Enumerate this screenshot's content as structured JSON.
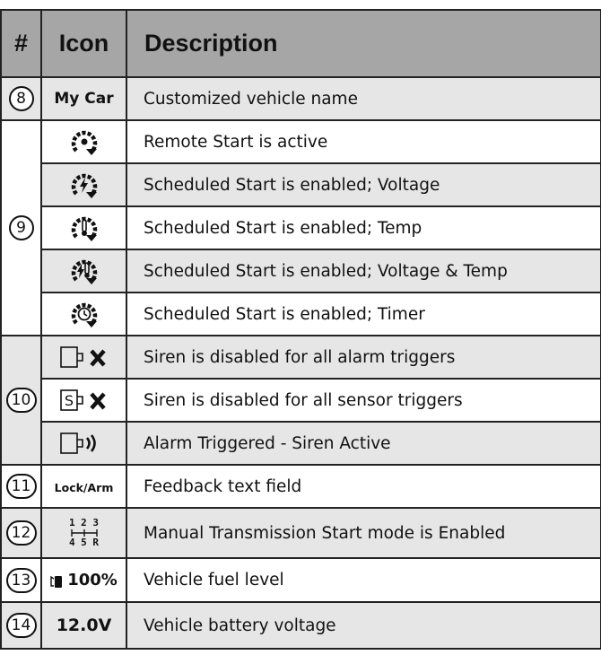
{
  "header": {
    "num": "#",
    "icon": "Icon",
    "description": "Description"
  },
  "rows": {
    "r8": {
      "num": "8",
      "icon_text": "My Car",
      "desc": "Customized vehicle name"
    },
    "r9a": {
      "num": "9",
      "icon": "remote-start-icon",
      "desc": "Remote Start is active"
    },
    "r9b": {
      "icon": "scheduled-voltage-icon",
      "desc": "Scheduled Start is enabled; Voltage"
    },
    "r9c": {
      "icon": "scheduled-temp-icon",
      "desc": "Scheduled Start is enabled; Temp"
    },
    "r9d": {
      "icon": "scheduled-voltage-temp-icon",
      "desc": "Scheduled Start is enabled; Voltage & Temp"
    },
    "r9e": {
      "icon": "scheduled-timer-icon",
      "desc": "Scheduled Start is enabled; Timer"
    },
    "r10a": {
      "num": "10",
      "icon": "siren-alarm-disabled-icon",
      "desc": "Siren is disabled for all alarm triggers"
    },
    "r10b": {
      "icon": "siren-sensor-disabled-icon",
      "icon_letter": "S",
      "desc": "Siren is disabled for all sensor triggers"
    },
    "r10c": {
      "icon": "siren-active-icon",
      "desc": "Alarm Triggered - Siren Active"
    },
    "r11": {
      "num": "11",
      "icon_text": "Lock/Arm",
      "desc": "Feedback text field"
    },
    "r12": {
      "num": "12",
      "gear_top": "1 2 3",
      "gear_bottom": "4 5 R",
      "desc": "Manual Transmission Start mode is Enabled"
    },
    "r13": {
      "num": "13",
      "icon_text": "100%",
      "desc": "Vehicle fuel level"
    },
    "r14": {
      "num": "14",
      "icon_text": "12.0V",
      "desc": "Vehicle battery voltage"
    }
  },
  "colors": {
    "header_bg": "#a6a6a6",
    "alt_row_bg": "#e6e6e6",
    "border": "#222222"
  }
}
